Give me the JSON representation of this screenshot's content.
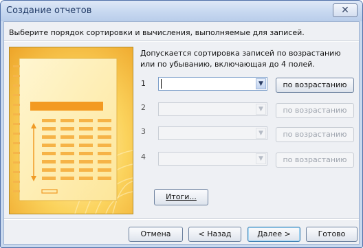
{
  "window": {
    "title": "Создание отчетов",
    "close_glyph": "✕"
  },
  "instruction": "Выберите порядок сортировки и вычисления, выполняемые для записей.",
  "description": "Допускается сортировка записей по возрастанию или по убыванию, включающая до 4 полей.",
  "sort_rows": [
    {
      "num": "1",
      "field_value": "",
      "order_label": "по возрастанию",
      "enabled": true
    },
    {
      "num": "2",
      "field_value": "",
      "order_label": "по возрастанию",
      "enabled": false
    },
    {
      "num": "3",
      "field_value": "",
      "order_label": "по возрастанию",
      "enabled": false
    },
    {
      "num": "4",
      "field_value": "",
      "order_label": "по возрастанию",
      "enabled": false
    }
  ],
  "summary_button": {
    "label": "Итоги...",
    "accesskey": "И"
  },
  "footer": {
    "cancel": "Отмена",
    "back": "< Назад",
    "next": "Далее >",
    "finish": "Готово"
  },
  "colors": {
    "accent": "#4f6fa8",
    "illustration_bg": "#f7c84a"
  },
  "icons": {
    "dropdown": "chevron-down-icon",
    "close": "close-icon"
  }
}
